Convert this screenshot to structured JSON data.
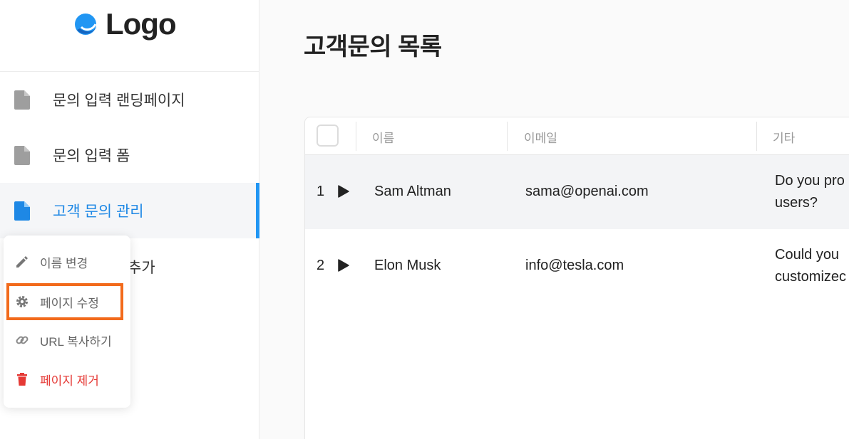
{
  "brand": {
    "logo_text": "Logo",
    "logo_color": "#2196f3"
  },
  "sidebar": {
    "items": [
      {
        "label": "문의 입력 랜딩페이지",
        "icon": "document-icon"
      },
      {
        "label": "문의 입력 폼",
        "icon": "document-icon"
      },
      {
        "label": "고객 문의 관리",
        "icon": "document-icon",
        "active": true
      },
      {
        "label": "추가",
        "icon": "document-icon"
      }
    ]
  },
  "context_menu": {
    "items": [
      {
        "label": "이름 변경",
        "icon": "pencil-icon"
      },
      {
        "label": "페이지 수정",
        "icon": "gear-icon",
        "highlighted": true
      },
      {
        "label": "URL 복사하기",
        "icon": "link-icon"
      },
      {
        "label": "페이지 제거",
        "icon": "trash-icon",
        "danger": true
      }
    ]
  },
  "main": {
    "title": "고객문의 목록",
    "table": {
      "columns": [
        "이름",
        "이메일",
        "기타"
      ],
      "rows": [
        {
          "index": "1",
          "name": "Sam Altman",
          "email": "sama@openai.com",
          "etc_line1": "Do you pro",
          "etc_line2": "users?"
        },
        {
          "index": "2",
          "name": "Elon Musk",
          "email": "info@tesla.com",
          "etc_line1": "Could you",
          "etc_line2": "customizec"
        }
      ]
    }
  },
  "colors": {
    "accent": "#2196f3",
    "highlight_border": "#f26a1b",
    "danger": "#e53935"
  }
}
